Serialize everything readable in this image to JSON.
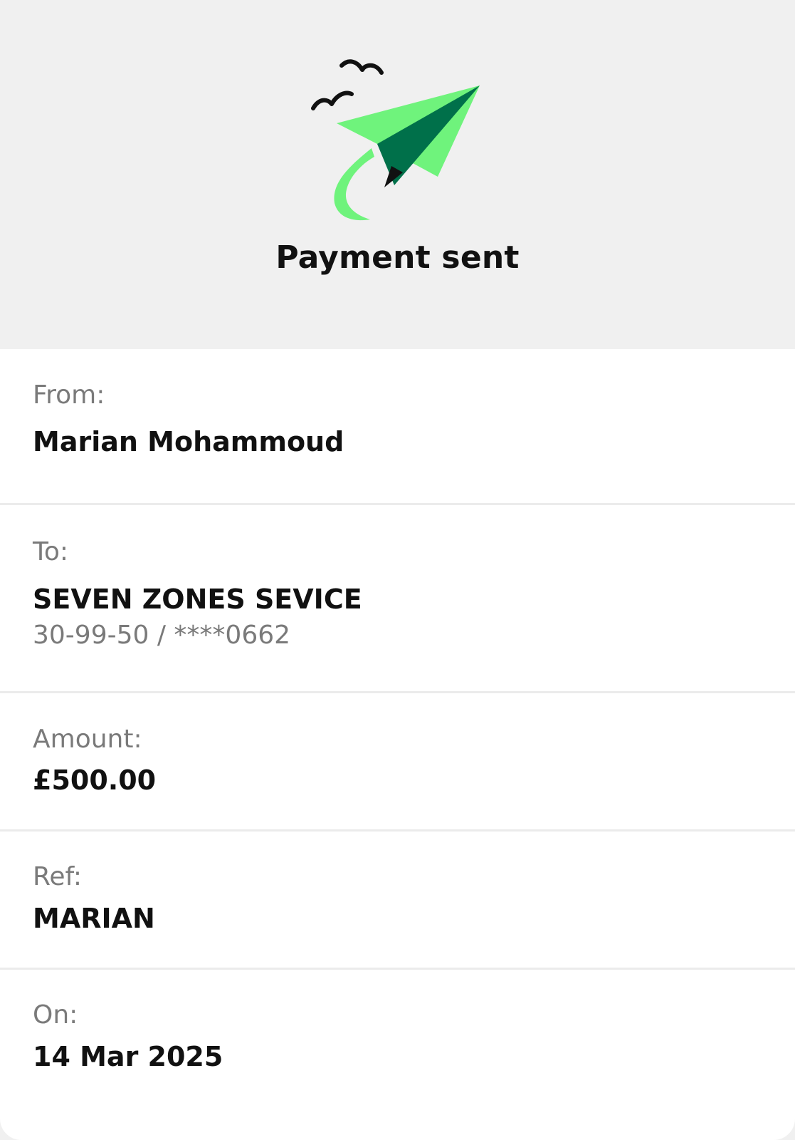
{
  "header": {
    "title": "Payment sent",
    "illustration_icon": "paper-plane-icon",
    "accent_color": "#6ff37c",
    "dark_accent_color": "#00704a"
  },
  "details": {
    "from": {
      "label": "From:",
      "value": "Marian Mohammoud"
    },
    "to": {
      "label": "To:",
      "value": "SEVEN ZONES SEVICE",
      "account": "30-99-50 / ****0662"
    },
    "amount": {
      "label": "Amount:",
      "value": "£500.00"
    },
    "ref": {
      "label": "Ref:",
      "value": "MARIAN"
    },
    "on": {
      "label": "On:",
      "value": "14 Mar 2025"
    }
  }
}
